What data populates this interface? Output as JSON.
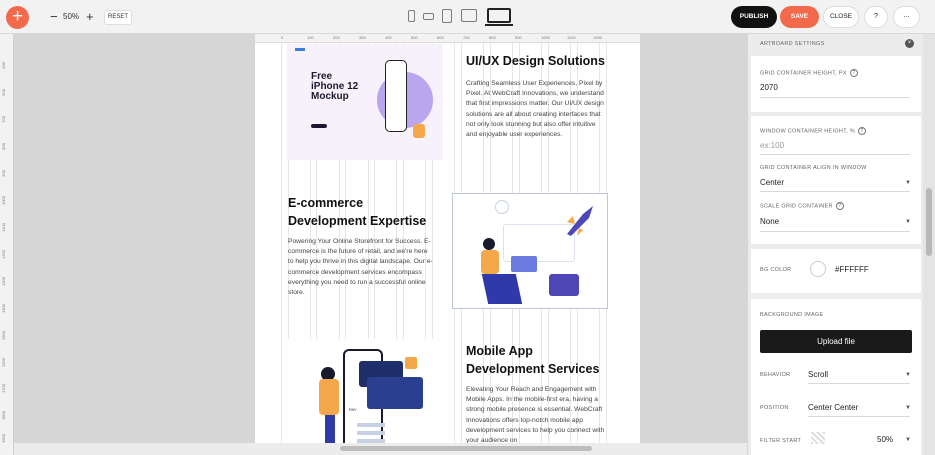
{
  "toolbar": {
    "add_label": "+",
    "zoom_out_label": "−",
    "zoom_value": "50%",
    "zoom_in_label": "+",
    "reset_label": "RESET",
    "publish_label": "PUBLISH",
    "save_label": "SAVE",
    "close_label": "CLOSE",
    "help_label": "?",
    "more_label": "...",
    "accent_color": "#f26a4b"
  },
  "ruler": {
    "top_ticks": [
      "0",
      "100",
      "200",
      "300",
      "400",
      "500",
      "600",
      "700",
      "800",
      "900",
      "1000",
      "1100",
      "1200"
    ],
    "left_ticks": [
      "500",
      "600",
      "700",
      "800",
      "900",
      "1000",
      "1100",
      "1200",
      "1300",
      "1400",
      "1500",
      "1600",
      "1700",
      "1800",
      "1900",
      "2000"
    ]
  },
  "content": {
    "heading_uiux": "UI/UX Design Solutions",
    "para_uiux": "Crafting Seamless User Experiences, Pixel by Pixel. At WebCraft Innovations, we understand that first impressions matter. Our UI/UX design solutions are all about creating interfaces that not only look stunning but also offer intuitive and enjoyable user experiences.",
    "heading_ecom_1": "E-commerce",
    "heading_ecom_2": "Development Expertise",
    "para_ecom": "Powering Your Online Storefront for Success. E-commerce is the future of retail, and we're here to help you thrive in this digital landscape. Our e-commerce development services encompass everything you need to run a successful online store.",
    "heading_mobile_1": "Mobile App",
    "heading_mobile_2": "Development Services",
    "para_mobile": "Elevating Your Reach and Engagement with Mobile Apps. In the mobile-first era, having a strong mobile presence is essential. WebCraft Innovations offers top-notch mobile app development services to help you connect with your audience on",
    "mockup_line1": "Free",
    "mockup_line2": "iPhone 12",
    "mockup_line3": "Mockup",
    "card_pay_label": "PAY"
  },
  "panel": {
    "title": "ARTBOARD SETTINGS",
    "grid_height_label": "GRID CONTAINER HEIGHT, PX",
    "grid_height_value": "2070",
    "window_height_label": "WINDOW CONTAINER HEIGHT, %",
    "window_height_placeholder": "ex:100",
    "align_label": "GRID CONTAINER ALIGN IN WINDOW",
    "align_value": "Center",
    "scale_label": "SCALE GRID CONTAINER",
    "scale_value": "None",
    "bg_color_label": "BG COLOR",
    "bg_color_value": "#FFFFFF",
    "bg_image_label": "BACKGROUND IMAGE",
    "upload_label": "Upload file",
    "behavior_label": "BEHAVIOR",
    "behavior_value": "Scroll",
    "position_label": "POSITION",
    "position_value": "Center Center",
    "filter_label": "FILTER START",
    "filter_value": "50%"
  }
}
